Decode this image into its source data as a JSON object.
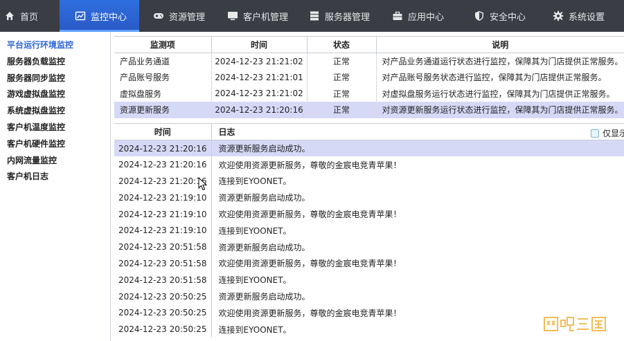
{
  "nav": {
    "items": [
      {
        "label": "首页"
      },
      {
        "label": "监控中心"
      },
      {
        "label": "资源管理"
      },
      {
        "label": "客户机管理"
      },
      {
        "label": "服务器管理"
      },
      {
        "label": "应用中心"
      },
      {
        "label": "安全中心"
      },
      {
        "label": "系统设置"
      }
    ],
    "active_index": 1
  },
  "sidebar": {
    "items": [
      {
        "label": "平台运行环境监控"
      },
      {
        "label": "服务器负载监控"
      },
      {
        "label": "服务器同步监控"
      },
      {
        "label": "游戏虚拟盘监控"
      },
      {
        "label": "系统虚拟盘监控"
      },
      {
        "label": "客户机温度监控"
      },
      {
        "label": "客户机硬件监控"
      },
      {
        "label": "内网流量监控"
      },
      {
        "label": "客户机日志"
      }
    ],
    "active_index": 0
  },
  "monitor_table": {
    "headers": [
      "监测项",
      "时间",
      "状态",
      "说明"
    ],
    "rows": [
      {
        "item": "产品业务通道",
        "time": "2024-12-23 21:21:02",
        "status": "正常",
        "desc": "对产品业务通道运行状态进行监控，保障其为门店提供正常服务。"
      },
      {
        "item": "产品账号服务",
        "time": "2024-12-23 21:21:01",
        "status": "正常",
        "desc": "对产品账号服务状态进行监控，保障其为门店提供正常服务。"
      },
      {
        "item": "虚拟盘服务",
        "time": "2024-12-23 21:21:02",
        "status": "正常",
        "desc": "对虚拟盘服务运行状态进行监控，保障其为门店提供正常服务。"
      },
      {
        "item": "资源更新服务",
        "time": "2024-12-23 21:20:16",
        "status": "正常",
        "desc": "对资源更新服务运行状态进行监控，保障其为门店提供正常服务。"
      }
    ],
    "selected_index": 3
  },
  "log_table": {
    "headers": [
      "时间",
      "日志"
    ],
    "filter_label": "仅显示",
    "rows": [
      {
        "time": "2024-12-23 21:20:16",
        "log": "资源更新服务启动成功。"
      },
      {
        "time": "2024-12-23 21:20:16",
        "log": "欢迎使用资源更新服务，尊敬的金宸电竞青苹果！"
      },
      {
        "time": "2024-12-23 21:20:16",
        "log": "连接到EYOONET。"
      },
      {
        "time": "2024-12-23 21:19:10",
        "log": "资源更新服务启动成功。"
      },
      {
        "time": "2024-12-23 21:19:10",
        "log": "欢迎使用资源更新服务，尊敬的金宸电竞青苹果！"
      },
      {
        "time": "2024-12-23 21:19:10",
        "log": "连接到EYOONET。"
      },
      {
        "time": "2024-12-23 20:51:58",
        "log": "资源更新服务启动成功。"
      },
      {
        "time": "2024-12-23 20:51:58",
        "log": "欢迎使用资源更新服务，尊敬的金宸电竞青苹果！"
      },
      {
        "time": "2024-12-23 20:51:58",
        "log": "连接到EYOONET。"
      },
      {
        "time": "2024-12-23 20:50:25",
        "log": "资源更新服务启动成功。"
      },
      {
        "time": "2024-12-23 20:50:25",
        "log": "欢迎使用资源更新服务，尊敬的金宸电竞青苹果！"
      },
      {
        "time": "2024-12-23 20:50:25",
        "log": "连接到EYOONET。"
      }
    ],
    "selected_index": 0
  },
  "watermark": {
    "text": "网吧三国"
  },
  "colors": {
    "nav_bg": "#3a3d44",
    "nav_active": "#2f6fe0",
    "side_active": "#2c63d8",
    "row_selected": "#d6d9f6",
    "watermark": "#f2b23a"
  }
}
